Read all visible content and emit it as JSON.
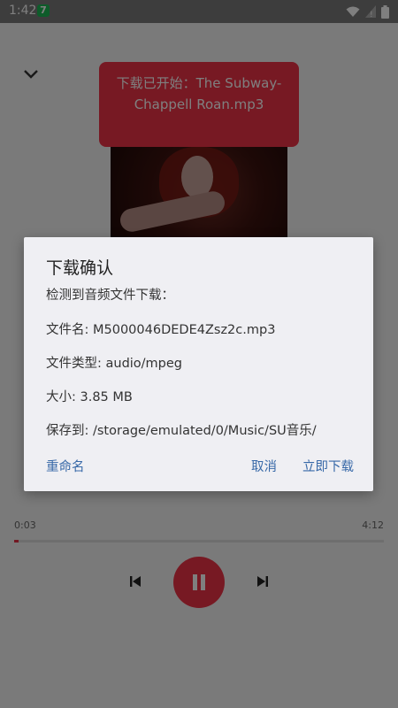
{
  "status_bar": {
    "time": "1:42",
    "notification_badge": "7"
  },
  "player": {
    "toast_text": "下载已开始：The Subway-Chappell Roan.mp3",
    "time_current": "0:03",
    "time_total": "4:12",
    "progress_fraction": 0.012,
    "accent_color": "#ee3346"
  },
  "dialog": {
    "title": "下载确认",
    "lines": [
      "检测到音频文件下载：",
      "文件名: M5000046DEDE4Zsz2c.mp3",
      "文件类型: audio/mpeg",
      "大小: 3.85 MB",
      "保存到: /storage/emulated/0/Music/SU音乐/"
    ],
    "rename_label": "重命名",
    "cancel_label": "取消",
    "download_label": "立即下载",
    "button_color": "#3869a8"
  },
  "icons": {
    "collapse": "chevron-down-icon",
    "prev": "skip-previous-icon",
    "next": "skip-next-icon",
    "pause": "pause-icon",
    "wifi": "wifi-icon",
    "battery": "battery-icon"
  }
}
